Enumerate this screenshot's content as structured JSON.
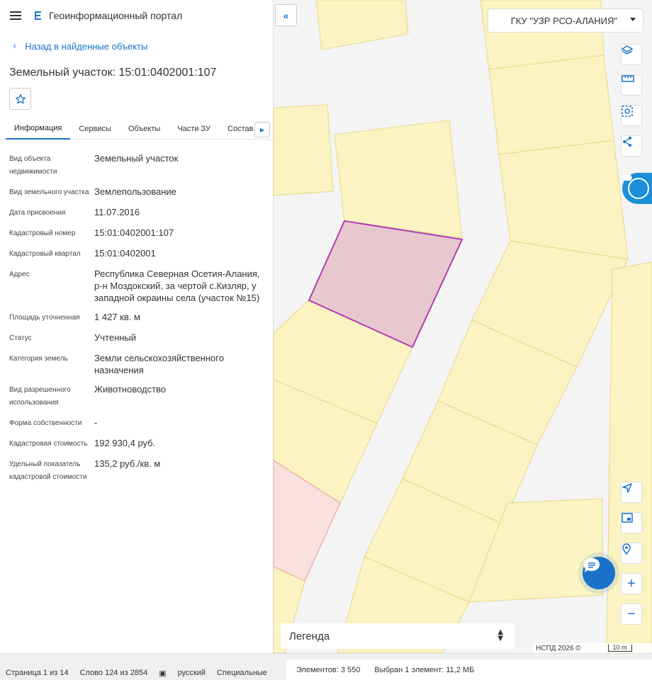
{
  "header": {
    "title": "Геоинформационный портал"
  },
  "back_link": "Назад в найденные объекты",
  "object_title": "Земельный участок: 15:01:0402001:107",
  "tabs": [
    "Информация",
    "Сервисы",
    "Объекты",
    "Части ЗУ",
    "Состав"
  ],
  "properties": [
    {
      "key": "Вид объекта недвижимости",
      "value": "Земельный участок"
    },
    {
      "key": "Вид земельного участка",
      "value": "Землепользование"
    },
    {
      "key": "Дата присвоения",
      "value": "11.07.2016"
    },
    {
      "key": "Кадастровый номер",
      "value": "15:01:0402001:107"
    },
    {
      "key": "Кадастровый квартал",
      "value": "15:01:0402001"
    },
    {
      "key": "Адрес",
      "value": "Республика Северная Осетия-Алания, р-н Моздокский, за чертой с.Кизляр, у западной окраины села (участок №15)"
    },
    {
      "key": "Площадь уточненная",
      "value": "1 427 кв. м"
    },
    {
      "key": "Статус",
      "value": "Учтенный"
    },
    {
      "key": "Категория земель",
      "value": "Земли сельскохозяйственного назначения"
    },
    {
      "key": "Вид разрешенного использования",
      "value": "Животноводство"
    },
    {
      "key": "Форма собственности",
      "value": "-"
    },
    {
      "key": "Кадастровая стоимость",
      "value": "192 930,4 руб."
    },
    {
      "key": "Удельный показатель кадастровой стоимости",
      "value": "135,2 руб./кв. м"
    }
  ],
  "map": {
    "org_select": "ГКУ \"УЗР РСО-АЛАНИЯ\"",
    "legend": "Легенда",
    "attribution": "НСПД 2026 ©",
    "scale": "10 m"
  },
  "statusbar": {
    "page": "Страница 1 из 14",
    "word": "Слово 124 из 2854",
    "language": "русский",
    "special": "Специальные",
    "elements": "Элементов: 3 550",
    "selected": "Выбран 1 элемент: 11,2 МБ"
  },
  "colors": {
    "accent": "#1a73c8",
    "parcel_fill": "#fbf3c1",
    "parcel_stroke": "#e6d98a",
    "selected_fill": "#e8c8cf",
    "selected_stroke": "#b13cb3",
    "pink_fill": "#f9e1df",
    "pink_stroke": "#f0a59a"
  },
  "icons": [
    "menu-icon",
    "portal-logo-icon",
    "chevron-left-icon",
    "star-icon",
    "caret-right-icon",
    "double-chevron-left-icon",
    "layers-icon",
    "ruler-icon",
    "select-area-icon",
    "share-icon",
    "navigate-icon",
    "minimap-icon",
    "location-pin-icon",
    "plus-icon",
    "minus-icon",
    "chat-icon"
  ]
}
